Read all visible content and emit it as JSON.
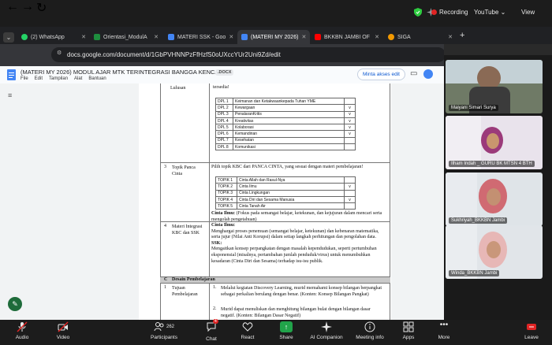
{
  "zoom_top": {
    "recording": "Recording",
    "youtube": "YouTube",
    "view": "View"
  },
  "tabs": [
    {
      "label": "(2) WhatsApp",
      "color": "#25d366"
    },
    {
      "label": "Orientasi_ModulA",
      "color": "#1e8e3e"
    },
    {
      "label": "MATERI SSK - Goo",
      "color": "#4285f4"
    },
    {
      "label": "(MATERI MY 2026)",
      "color": "#4285f4"
    },
    {
      "label": "BKKBN JAMBI OF",
      "color": "#ff0000"
    },
    {
      "label": "SIGA",
      "color": "#f29900"
    }
  ],
  "address": {
    "url": "docs.google.com/document/d/1GbPVHNNPzFfHzfS0oUXccYUr2Uni9Zd/edit"
  },
  "docs": {
    "title": "(MATERI MY 2026) MODUL AJAR MTK TERINTEGRASI BANGGA KENCANA",
    "badge": ".DOCX",
    "menus": [
      "File",
      "Edit",
      "Tampilan",
      "Alat",
      "Bantuan"
    ],
    "request_access": "Minta akses edit",
    "row_a": {
      "label": "Lulusan",
      "text": "tersedia!"
    },
    "dpl": [
      {
        "code": "DPL 1",
        "name": "Keimanan dan Ketakwaankepada Tuhan YME",
        "check": ""
      },
      {
        "code": "DPL 2",
        "name": "Kewargaan",
        "check": "v"
      },
      {
        "code": "DPL 3",
        "name": "PenalaranKritis",
        "check": "v"
      },
      {
        "code": "DPL 4",
        "name": "Kreativitas",
        "check": "v"
      },
      {
        "code": "DPL 5",
        "name": "Kolaborasi",
        "check": "v"
      },
      {
        "code": "DPL 6",
        "name": "Kemandirian",
        "check": "v"
      },
      {
        "code": "DPL 7",
        "name": "Kesehatan",
        "check": ""
      },
      {
        "code": "DPL 8",
        "name": "Komunikasi",
        "check": ""
      }
    ],
    "row3": {
      "num": "3",
      "label": "Topik Panca Cinta",
      "intro": "Pilih topik KBC dari PANCA CINTA, yang sesuai dengan materi pembelajaran!",
      "topics": [
        {
          "code": "TOPIK 1",
          "name": "Cinta Allah dan Rasul-Nya",
          "check": ""
        },
        {
          "code": "TOPIK 2",
          "name": "Cinta Ilmu",
          "check": "v"
        },
        {
          "code": "TOPIK 3",
          "name": "Cinta Lingkungan",
          "check": ""
        },
        {
          "code": "TOPIK 4",
          "name": "Cinta Diri dan Sesama Manusia",
          "check": "v"
        },
        {
          "code": "TOPIK 5",
          "name": "Cinta Tanah Air",
          "check": ""
        }
      ],
      "note_bold": "Cinta Ilmu:",
      "note": " (Fokus pada semangat belajar, ketekunan, dan kejujuran dalam mencari serta mengolah pengetahuan)"
    },
    "row4": {
      "num": "4",
      "label": "Materi Integrasi KBC dan SSK",
      "head1": "Cinta Ilmu:",
      "p1": "Menghargai proses penemuan (semangat belajar, ketekunan) dan kebenaran matematika, serta jujur (Nilai Anti Korupsi) dalam setiap langkah perhitungan dan pengolahan data.",
      "head2": "SSK:",
      "p2": "Mengaitkan konsep perpangkatan dengan masalah kependudukan, seperti pertumbuhan eksponensial (misalnya, pertambahan jumlah penduduk/virus) untuk menumbuhkan kesadaran (Cinta Diri dan Sesama) terhadap isu-isu publik."
    },
    "section_c": {
      "letter": "C",
      "title": "Desain Pembelajaran"
    },
    "row1": {
      "num": "1",
      "label": "Tujuan Pembelajaran",
      "items": [
        "Melalui kegiatan Discovery Learning, murid memahami konsep bilangan berpangkat sebagai perkalian berulang dengan benar. (Konten: Konsep Bilangan Pangkat)",
        "Murid dapat menuliskan dan menghitung bilangan bulat dengan bilangan dasar negatif. (Konten: Bilangan Dasar Negatif)"
      ]
    }
  },
  "participants": [
    {
      "name": "Maiyani Simari Surya",
      "bg": "#6f7a66"
    },
    {
      "name": "Ilham Indah _ GURU BK MTSN 4 BTH",
      "bg": "#d8ccd6"
    },
    {
      "name": "Sukhriyah_BKKBN Jambi",
      "bg": "#d2d8de"
    },
    {
      "name": "Winda_BKKBN Jambi",
      "bg": "#d6dbe0"
    }
  ],
  "bottom_bar": {
    "audio": "Audio",
    "video": "Video",
    "participants": "Participants",
    "participants_count": "262",
    "chat": "Chat",
    "chat_badge": "4",
    "react": "React",
    "share": "Share",
    "ai": "AI Companion",
    "meeting": "Meeting info",
    "apps": "Apps",
    "more": "More",
    "leave": "Leave"
  }
}
